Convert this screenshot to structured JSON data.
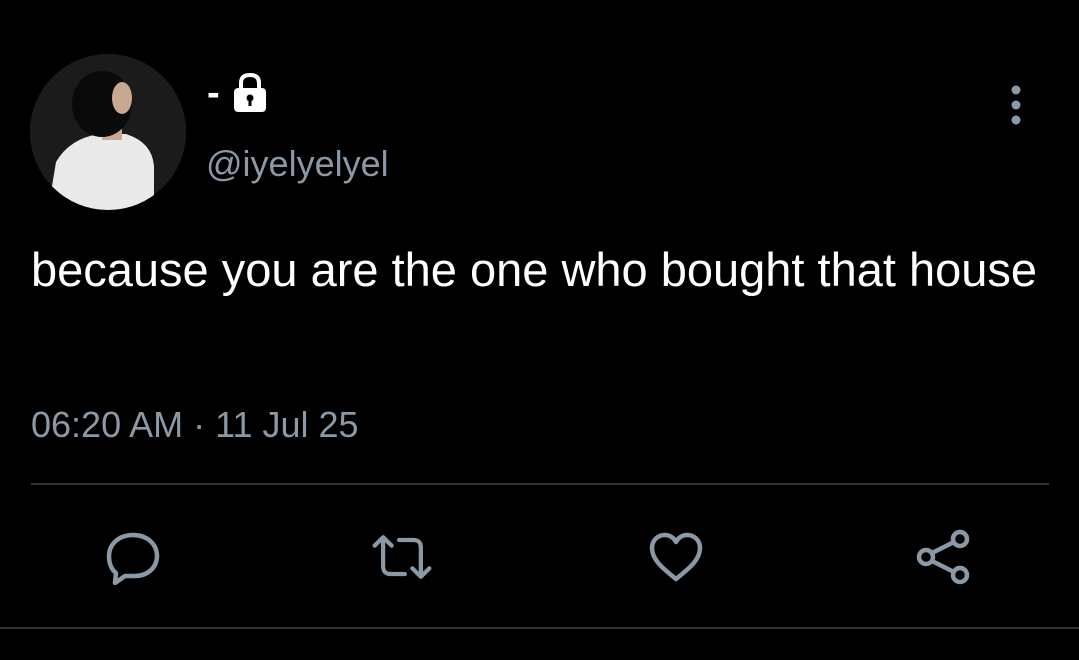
{
  "author": {
    "display_name": "-",
    "handle": "@iyelyelyel",
    "protected": true
  },
  "tweet": {
    "text": "because you are the one who bought that house",
    "time": "06:20 AM",
    "separator": "·",
    "date": "11 Jul 25"
  },
  "icons": {
    "lock": "lock-icon",
    "more": "more-vertical-icon",
    "reply": "reply-bubble-icon",
    "retweet": "retweet-icon",
    "like": "heart-icon",
    "share": "share-icon"
  },
  "colors": {
    "background": "#000000",
    "primary_text": "#ffffff",
    "secondary_text": "#8b98a5",
    "divider": "#2f3336"
  }
}
